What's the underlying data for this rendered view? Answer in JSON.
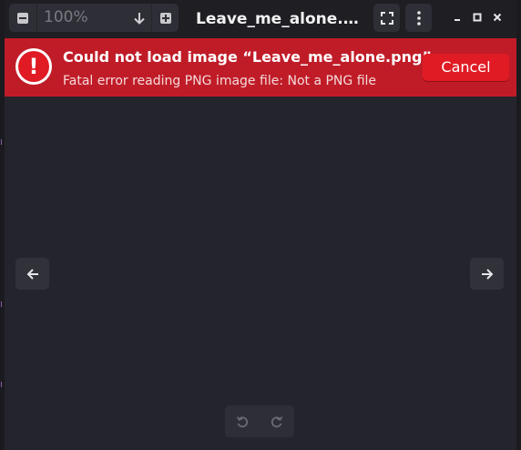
{
  "header": {
    "zoom_value": "100%",
    "title": "Leave_me_alone.png",
    "zoom_out_icon": "minus-icon",
    "zoom_in_icon": "plus-icon",
    "zoom_dropdown_icon": "arrow-down-icon",
    "fullscreen_icon": "fullscreen-icon",
    "menu_icon": "kebab-menu-icon",
    "window_controls": [
      "minimize-icon",
      "maximize-icon",
      "close-icon"
    ]
  },
  "banner": {
    "icon": "error-icon",
    "icon_glyph": "!",
    "title": "Could not load image “Leave_me_alone.png”.",
    "subtitle": "Fatal error reading PNG image file: Not a PNG file",
    "cancel_label": "Cancel",
    "background_color": "#c01c28"
  },
  "navigation": {
    "prev_icon": "arrow-left-icon",
    "next_icon": "arrow-right-icon"
  },
  "rotation": {
    "left_icon": "rotate-left-icon",
    "right_icon": "rotate-right-icon"
  },
  "colors": {
    "content_bg": "#24242c",
    "headerbar_bg": "#1e1e23",
    "button_bg": "#2e2e36"
  }
}
